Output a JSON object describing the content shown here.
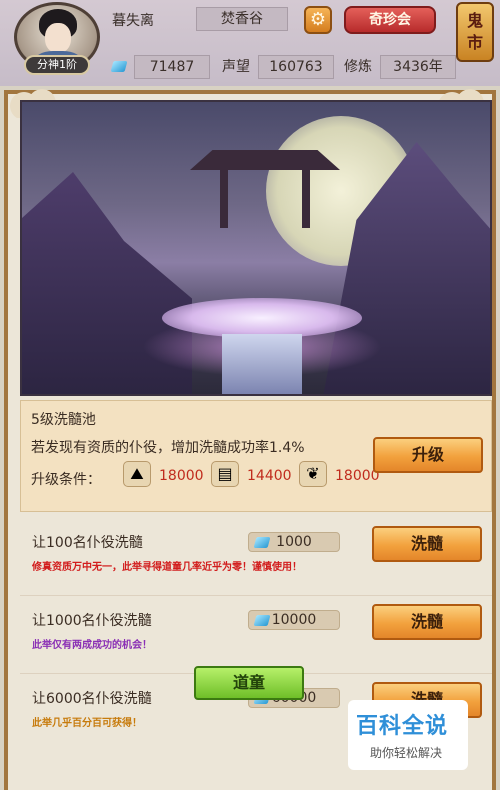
{
  "header": {
    "rank_badge": "分神1阶",
    "player_name": "暮失离",
    "sect": "焚香谷",
    "treasure_button": "奇珍会",
    "ghost_market": [
      "鬼",
      "市"
    ],
    "spirit_stones": "71487",
    "reputation_label": "声望",
    "reputation": "160763",
    "cultivation_label": "修炼",
    "cultivation": "3436年"
  },
  "upgrade": {
    "pool_level": "5级洗髓池",
    "description": "若发现有资质的仆役，增加洗髓成功率1.4%",
    "condition_label": "升级条件：",
    "materials": [
      {
        "icon": "ore-icon",
        "amount": "18000"
      },
      {
        "icon": "wood-icon",
        "amount": "14400"
      },
      {
        "icon": "herb-icon",
        "amount": "18000"
      }
    ],
    "button": "升级"
  },
  "wash_rows": [
    {
      "title": "让100名仆役洗髓",
      "cost": "1000",
      "note": "修真资质万中无一，此举寻得道童几率近乎为零！谨慎使用！",
      "note_color": "#d21d1d",
      "button": "洗髓"
    },
    {
      "title": "让1000名仆役洗髓",
      "cost": "10000",
      "note": "此举仅有两成成功的机会！",
      "note_color": "#8a2fb5",
      "button": "洗髓"
    },
    {
      "title": "让6000名仆役洗髓",
      "cost": "60000",
      "note": "此举几乎百分百可获得！",
      "note_color": "#c77b0c",
      "button": "洗髓"
    }
  ],
  "bottom_button": "道童",
  "watermark": {
    "title": "百科全说",
    "subtitle": "助你轻松解决"
  }
}
